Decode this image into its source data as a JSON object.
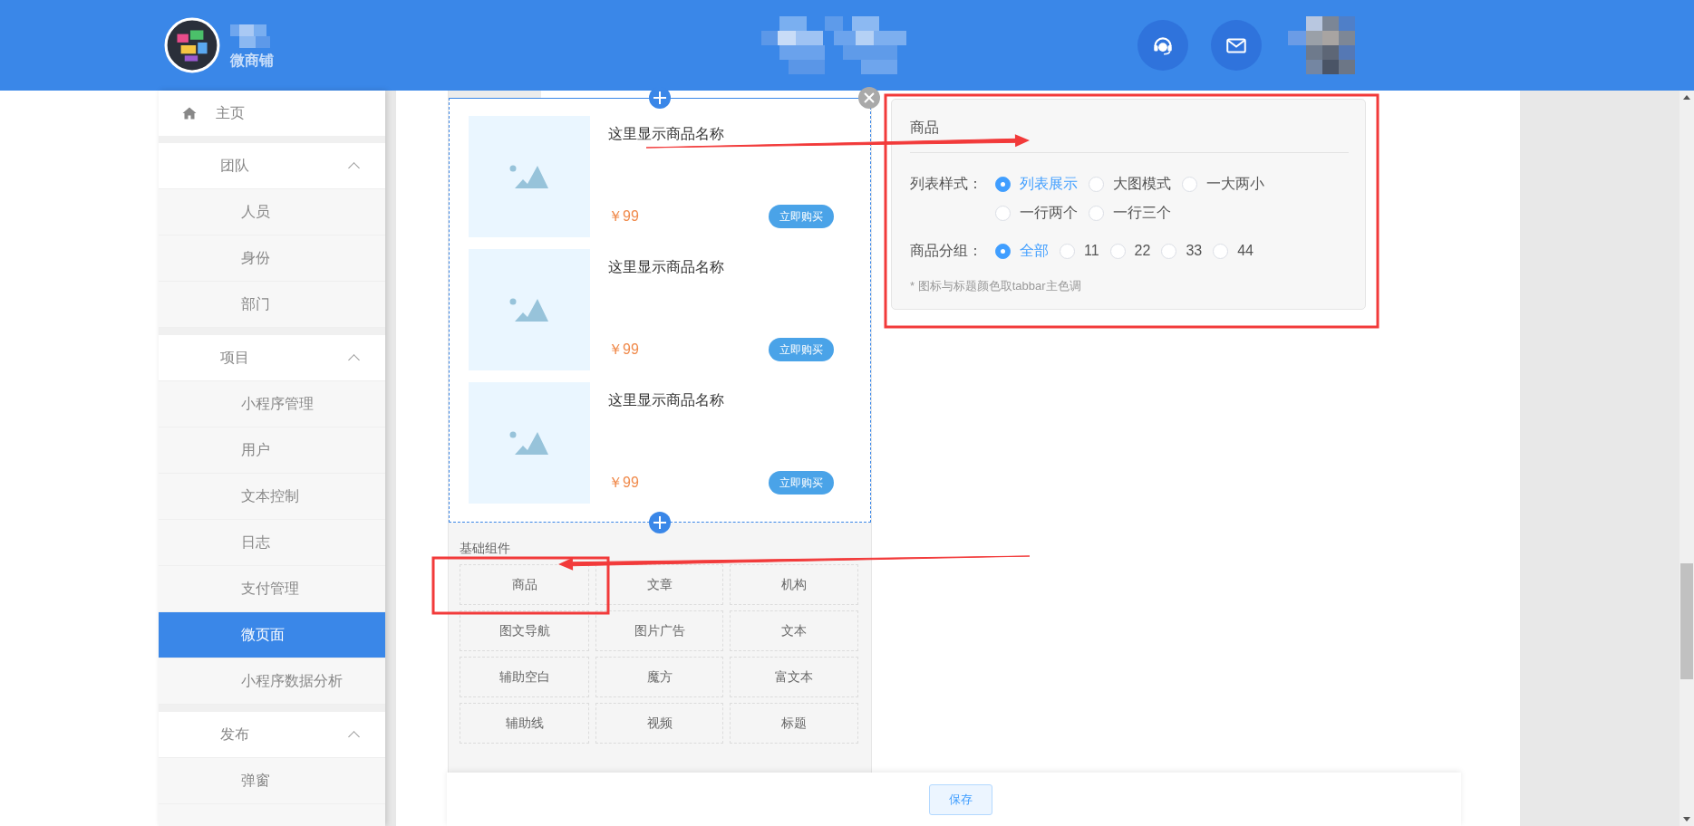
{
  "header": {
    "brand": "微商铺"
  },
  "sidebar": {
    "items": [
      {
        "kind": "link",
        "label": "主页",
        "selected": false
      },
      {
        "kind": "group",
        "label": "团队",
        "expanded": true,
        "children": [
          {
            "label": "人员",
            "selected": false
          },
          {
            "label": "身份",
            "selected": false
          },
          {
            "label": "部门",
            "selected": false
          }
        ]
      },
      {
        "kind": "group",
        "label": "项目",
        "expanded": true,
        "children": [
          {
            "label": "小程序管理",
            "selected": false
          },
          {
            "label": "用户",
            "selected": false
          },
          {
            "label": "文本控制",
            "selected": false
          },
          {
            "label": "日志",
            "selected": false
          },
          {
            "label": "支付管理",
            "selected": false
          },
          {
            "label": "微页面",
            "selected": true
          },
          {
            "label": "小程序数据分析",
            "selected": false
          }
        ]
      },
      {
        "kind": "group",
        "label": "发布",
        "expanded": true,
        "children": [
          {
            "label": "弹窗",
            "selected": false
          }
        ]
      }
    ]
  },
  "preview": {
    "products": [
      {
        "name": "这里显示商品名称",
        "price": "￥99",
        "button": "立即购买"
      },
      {
        "name": "这里显示商品名称",
        "price": "￥99",
        "button": "立即购买"
      },
      {
        "name": "这里显示商品名称",
        "price": "￥99",
        "button": "立即购买"
      }
    ]
  },
  "components": {
    "title": "基础组件",
    "items": [
      "商品",
      "文章",
      "机构",
      "图文导航",
      "图片广告",
      "文本",
      "辅助空白",
      "魔方",
      "富文本",
      "辅助线",
      "视频",
      "标题"
    ]
  },
  "config": {
    "title": "商品",
    "fields": [
      {
        "label": "列表样式：",
        "options": [
          {
            "label": "列表展示",
            "selected": true
          },
          {
            "label": "大图模式",
            "selected": false
          },
          {
            "label": "一大两小",
            "selected": false
          },
          {
            "label": "一行两个",
            "selected": false
          },
          {
            "label": "一行三个",
            "selected": false
          }
        ]
      },
      {
        "label": "商品分组：",
        "options": [
          {
            "label": "全部",
            "selected": true
          },
          {
            "label": "11",
            "selected": false
          },
          {
            "label": "22",
            "selected": false
          },
          {
            "label": "33",
            "selected": false
          },
          {
            "label": "44",
            "selected": false
          }
        ]
      }
    ],
    "note": "* 图标与标题颜色取tabbar主色调"
  },
  "save_button": "保存",
  "annotations": [
    {
      "kind": "frame"
    },
    {
      "kind": "arrow"
    },
    {
      "kind": "frame"
    },
    {
      "kind": "arrow"
    }
  ]
}
